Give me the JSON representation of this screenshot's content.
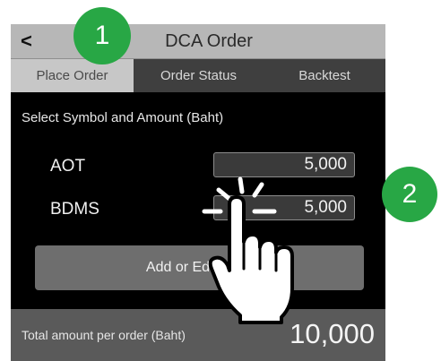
{
  "nav": {
    "back_label": "<",
    "title": "DCA Order"
  },
  "tabs": [
    {
      "label": "Place Order",
      "active": true
    },
    {
      "label": "Order Status",
      "active": false
    },
    {
      "label": "Backtest",
      "active": false
    }
  ],
  "form": {
    "section_title": "Select Symbol and Amount (Baht)",
    "rows": [
      {
        "symbol": "AOT",
        "amount": "5,000"
      },
      {
        "symbol": "BDMS",
        "amount": "5,000"
      }
    ],
    "add_edit_label": "Add or Edit"
  },
  "footer": {
    "label": "Total amount per order (Baht)",
    "total": "10,000"
  },
  "badges": [
    "1",
    "2"
  ],
  "colors": {
    "badge": "#28a745",
    "active_tab": "#c7c7c7"
  }
}
